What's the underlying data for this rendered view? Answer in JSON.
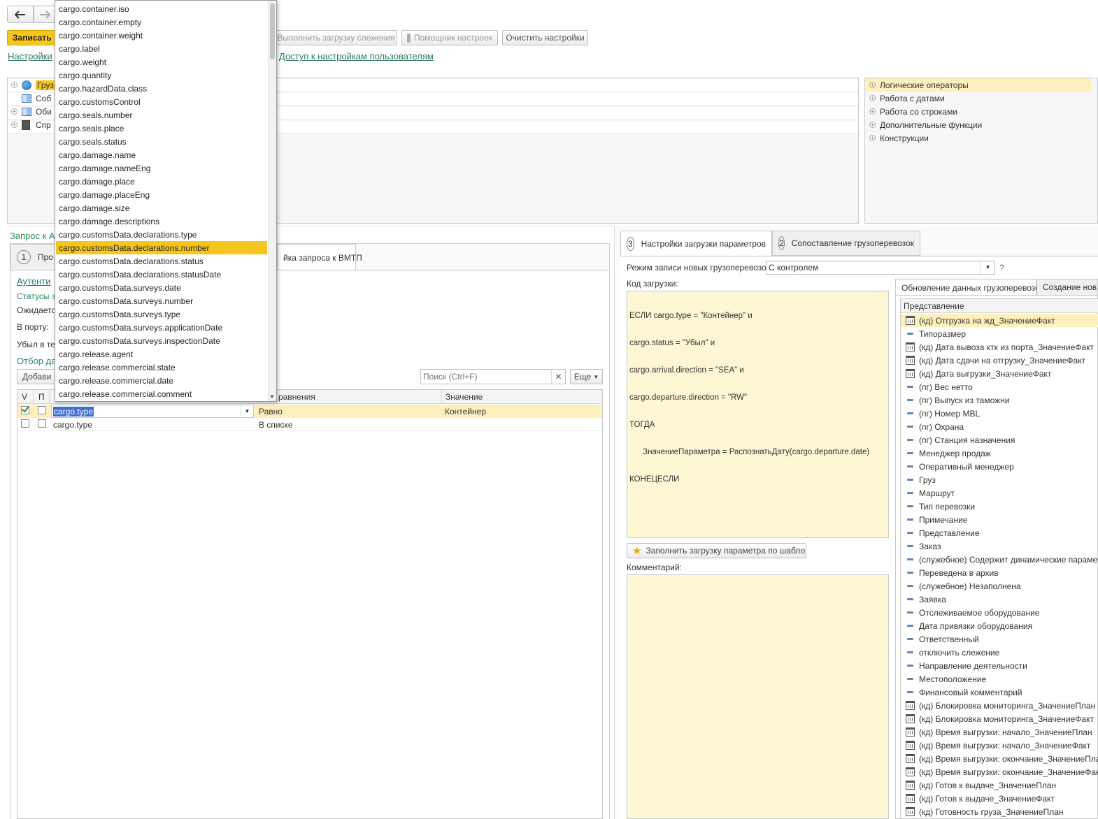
{
  "toolbar": {
    "back_icon": "arrow-left-icon",
    "forward_icon": "arrow-right-icon",
    "save_label": "Записать",
    "run_tracking_label": "Выполнить загрузку слежения",
    "settings_helper_label": "Помощник настроек",
    "clear_settings_label": "Очистить настройки",
    "settings_link": "Настройки",
    "user_access_link": "Доступ к настройкам пользователям"
  },
  "left_tree": {
    "items": [
      "Груз",
      "Соб",
      "Оби",
      "Спр"
    ]
  },
  "operators_panel": {
    "items": [
      "Логические операторы",
      "Работа с датами",
      "Работа со строками",
      "Дополнительные функции",
      "Конструкции"
    ]
  },
  "left_section": {
    "title": "Запрос к А",
    "step_number": "1",
    "step_label": "Про",
    "tab_vmtp": "йка запроса к ВМТП",
    "auth_link": "Аутенти",
    "statuses_label": "Статусы з",
    "expected_label": "Ожидаетс",
    "port_label": "В порту:",
    "departed_label": "Убыл в те",
    "filter_label": "Отбор да",
    "add_button": "Добави",
    "search_placeholder": "Поиск (Ctrl+F)",
    "more_button": "Еще",
    "table_headers": {
      "v": "V",
      "p": "П",
      "comparison": "равнения",
      "value": "Значение"
    },
    "rows": [
      {
        "field": "cargo.type",
        "comparison": "Равно",
        "value": "Контейнер",
        "checked": true
      },
      {
        "field": "cargo.type",
        "comparison": "В списке",
        "value": "",
        "checked": false
      }
    ]
  },
  "dropdown": {
    "items": [
      "cargo.container.iso",
      "cargo.container.empty",
      "cargo.container.weight",
      "cargo.label",
      "cargo.weight",
      "cargo.quantity",
      "cargo.hazardData.class",
      "cargo.customsControl",
      "cargo.seals.number",
      "cargo.seals.place",
      "cargo.seals.status",
      "cargo.damage.name",
      "cargo.damage.nameEng",
      "cargo.damage.place",
      "cargo.damage.placeEng",
      "cargo.damage.size",
      "cargo.damage.descriptions",
      "cargo.customsData.declarations.type",
      "cargo.customsData.declarations.number",
      "cargo.customsData.declarations.status",
      "cargo.customsData.declarations.statusDate",
      "cargo.customsData.surveys.date",
      "cargo.customsData.surveys.number",
      "cargo.customsData.surveys.type",
      "cargo.customsData.surveys.applicationDate",
      "cargo.customsData.surveys.inspectionDate",
      "cargo.release.agent",
      "cargo.release.commercial.state",
      "cargo.release.commercial.date",
      "cargo.release.commercial.comment"
    ],
    "selected": "cargo.customsData.declarations.number"
  },
  "right_section": {
    "tab3_number": "3",
    "tab3_label": "Настройки загрузки параметров",
    "tab2_number": "2",
    "tab2_label": "Сопоставление грузоперевозок",
    "mode_label": "Режим записи новых грузоперевозок:",
    "mode_value": "С контролем",
    "help": "?",
    "code_label": "Код загрузки:",
    "code_lines": [
      "ЕСЛИ cargo.type = \"Контейнер\" и",
      "cargo.status = \"Убыл\" и",
      "cargo.arrival.direction = \"SEA\" и",
      "cargo.departure.direction = \"RW\"",
      "ТОГДА",
      "      ЗначениеПараметра = РаспознатьДату(cargo.departure.date)",
      "КОНЕЦЕСЛИ"
    ],
    "fill_template_button": "Заполнить загрузку параметра по шаблону",
    "comment_label": "Комментарий:",
    "subtab_update": "Обновление данных грузоперевозок",
    "subtab_create": "Создание нов",
    "list_header": "Представление",
    "list": [
      {
        "icon": "calendar-icon",
        "label": "(кд) Отгрузка на жд_ЗначениеФакт"
      },
      {
        "icon": "dash-icon",
        "label": "Типоразмер"
      },
      {
        "icon": "calendar-icon",
        "label": "(кд) Дата вывоза ктк из порта_ЗначениеФакт"
      },
      {
        "icon": "calendar-icon",
        "label": "(кд) Дата сдачи на отгрузку_ЗначениеФакт"
      },
      {
        "icon": "calendar-icon",
        "label": "(кд) Дата выгрузки_ЗначениеФакт"
      },
      {
        "icon": "dash-icon",
        "label": "(пг) Вес нетто"
      },
      {
        "icon": "dash-icon",
        "label": "(пг) Выпуск из таможни"
      },
      {
        "icon": "dash-icon",
        "label": "(пг) Номер MBL"
      },
      {
        "icon": "dash-icon",
        "label": "(пг) Охрана"
      },
      {
        "icon": "dash-icon",
        "label": "(пг) Станция назначения"
      },
      {
        "icon": "dash-icon",
        "label": "Менеджер продаж"
      },
      {
        "icon": "dash-icon",
        "label": "Оперативный менеджер"
      },
      {
        "icon": "dash-icon",
        "label": "Груз"
      },
      {
        "icon": "dash-icon",
        "label": "Маршрут"
      },
      {
        "icon": "dash-icon",
        "label": "Тип перевозки"
      },
      {
        "icon": "dash-icon",
        "label": "Примечание"
      },
      {
        "icon": "dash-icon",
        "label": "Представление"
      },
      {
        "icon": "dash-icon",
        "label": "Заказ"
      },
      {
        "icon": "dash-icon",
        "label": "(служебное) Содержит динамические параметры"
      },
      {
        "icon": "dash-icon",
        "label": "Переведена в архив"
      },
      {
        "icon": "dash-icon",
        "label": "(служебное) Незаполнена"
      },
      {
        "icon": "dash-icon",
        "label": "Заявка"
      },
      {
        "icon": "dash-icon",
        "label": "Отслеживаемое оборудование"
      },
      {
        "icon": "dash-icon",
        "label": "Дата привязки оборудования"
      },
      {
        "icon": "dash-icon",
        "label": "Ответственный"
      },
      {
        "icon": "dash-icon",
        "label": "отключить слежение"
      },
      {
        "icon": "dash-icon",
        "label": "Направление деятельности"
      },
      {
        "icon": "dash-icon",
        "label": "Местоположение"
      },
      {
        "icon": "dash-icon",
        "label": "Финансовый комментарий"
      },
      {
        "icon": "calendar-icon",
        "label": "(кд) Блокировка мониторинга_ЗначениеПлан"
      },
      {
        "icon": "calendar-icon",
        "label": "(кд) Блокировка мониторинга_ЗначениеФакт"
      },
      {
        "icon": "calendar-icon",
        "label": "(кд) Время выгрузки: начало_ЗначениеПлан"
      },
      {
        "icon": "calendar-icon",
        "label": "(кд) Время выгрузки: начало_ЗначениеФакт"
      },
      {
        "icon": "calendar-icon",
        "label": "(кд) Время выгрузки: окончание_ЗначениеПлан"
      },
      {
        "icon": "calendar-icon",
        "label": "(кд) Время выгрузки: окончание_ЗначениеФакт"
      },
      {
        "icon": "calendar-icon",
        "label": "(кд) Готов к выдаче_ЗначениеПлан"
      },
      {
        "icon": "calendar-icon",
        "label": "(кд) Готов к выдаче_ЗначениеФакт"
      },
      {
        "icon": "calendar-icon",
        "label": "(кд) Готовность груза_ЗначениеПлан"
      }
    ],
    "selected_index": 0
  },
  "colors": {
    "accent_yellow": "#f7c61e",
    "selection_row": "#fdf0bd",
    "link_green": "#2b7a5a",
    "editor_bg": "#fdf7d4"
  }
}
